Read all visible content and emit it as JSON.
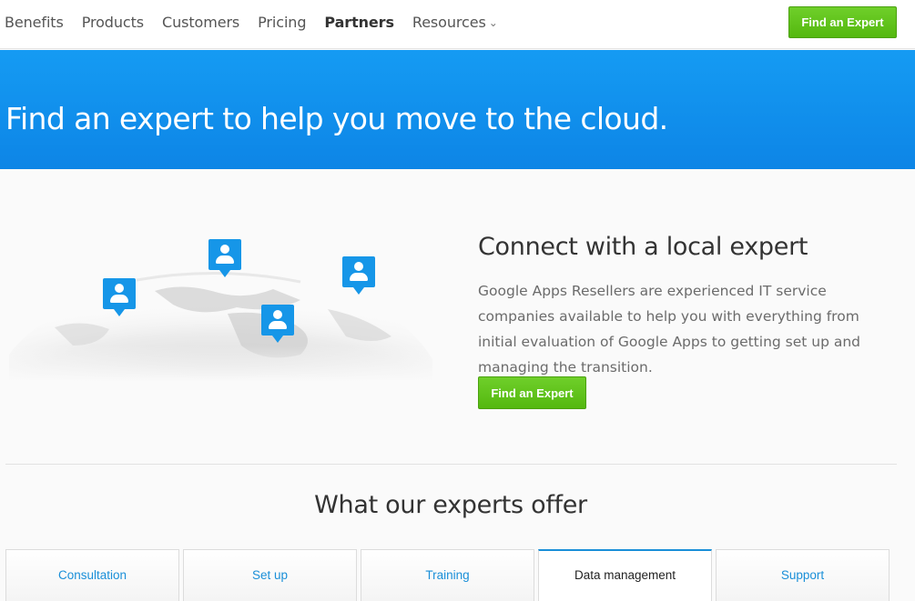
{
  "nav": {
    "items": [
      {
        "label": "Benefits"
      },
      {
        "label": "Products"
      },
      {
        "label": "Customers"
      },
      {
        "label": "Pricing"
      },
      {
        "label": "Partners",
        "active": true
      },
      {
        "label": "Resources",
        "dropdown": true
      }
    ],
    "cta_label": "Find an Expert"
  },
  "hero": {
    "title": "Find an expert to help you move to the cloud."
  },
  "connect": {
    "title": "Connect with a local expert",
    "text": "Google Apps Resellers are experienced IT service companies available to help you with everything from initial evaluation of Google Apps to getting set up and managing the transition.",
    "cta_label": "Find an Expert"
  },
  "offer": {
    "title": "What our experts offer",
    "tabs": [
      {
        "label": "Consultation"
      },
      {
        "label": "Set up"
      },
      {
        "label": "Training"
      },
      {
        "label": "Data management",
        "active": true
      },
      {
        "label": "Support"
      }
    ]
  },
  "colors": {
    "accent_blue": "#1696e8",
    "cta_green": "#5cc41a",
    "hero_blue": "#0d85e6"
  }
}
